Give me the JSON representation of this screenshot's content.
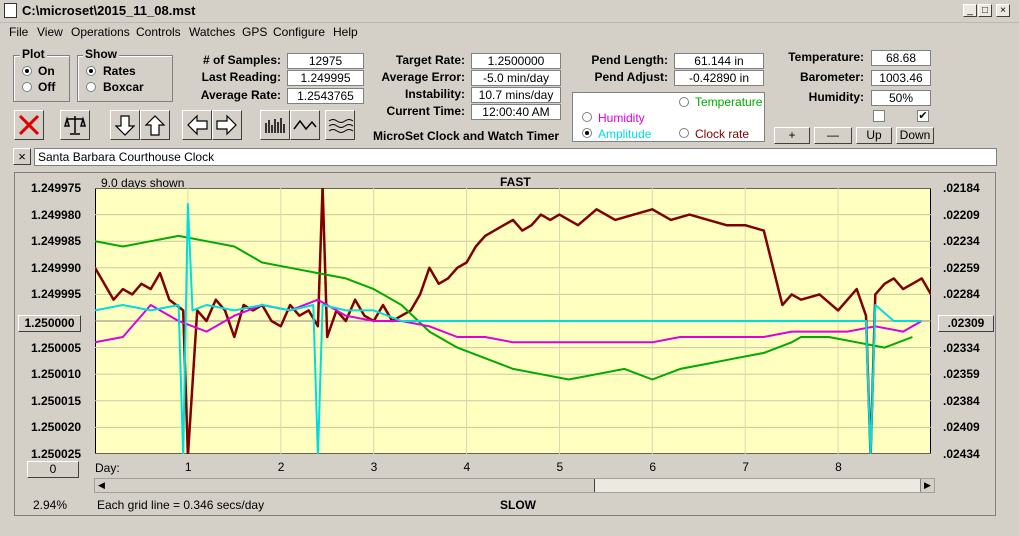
{
  "window": {
    "title": "C:\\microset\\2015_11_08.mst",
    "min": "_",
    "max": "□",
    "close": "×"
  },
  "menu": [
    "File",
    "View",
    "Operations",
    "Controls",
    "Watches",
    "GPS",
    "Configure",
    "Help"
  ],
  "plot_group": {
    "title": "Plot",
    "options": [
      "On",
      "Off"
    ],
    "selected": "On"
  },
  "show_group": {
    "title": "Show",
    "options": [
      "Rates",
      "Boxcar"
    ],
    "selected": "Rates"
  },
  "stats": {
    "samples_label": "# of Samples:",
    "samples": "12975",
    "last_label": "Last Reading:",
    "last": "1.249995",
    "avg_label": "Average Rate:",
    "avg": "1.2543765"
  },
  "rates": {
    "target_label": "Target Rate:",
    "target": "1.2500000",
    "error_label": "Average Error:",
    "error": "-5.0 min/day",
    "instab_label": "Instability:",
    "instab": "10.7 mins/day",
    "time_label": "Current Time:",
    "time": "12:00:40 AM"
  },
  "app_caption": "MicroSet Clock and Watch Timer",
  "pend": {
    "length_label": "Pend Length:",
    "length": "61.144 in",
    "adjust_label": "Pend Adjust:",
    "adjust": "-0.42890 in"
  },
  "series_select": {
    "temperature": "Temperature",
    "humidity": "Humidity",
    "amplitude": "Amplitude",
    "clock_rate": "Clock rate",
    "selected": "Amplitude"
  },
  "env": {
    "temp_label": "Temperature:",
    "temp": "68.68",
    "baro_label": "Barometer:",
    "baro": "1003.46",
    "hum_label": "Humidity:",
    "hum": "50%"
  },
  "adjust_buttons": [
    "+",
    "—",
    "Up",
    "Down"
  ],
  "clock_name": "Santa Barbara Courthouse Clock",
  "close_x": "×",
  "plot": {
    "days_shown": "9.0 days shown",
    "top_label": "FAST",
    "bottom_label": "SLOW",
    "left_center": "1.250000",
    "right_center": ".02309",
    "left_bottom_btn": "0",
    "day_label": "Day:",
    "grid_note": "Each grid line = 0.346 secs/day",
    "percent": "2.94%"
  },
  "chart_data": {
    "type": "line",
    "background": "#ffffc0",
    "ylim_left": [
      1.250025,
      1.249975
    ],
    "y_ticks_left": [
      "1.249975",
      "1.249980",
      "1.249985",
      "1.249990",
      "1.249995",
      "1.250005",
      "1.250010",
      "1.250015",
      "1.250020",
      "1.250025"
    ],
    "y_ticks_right": [
      ".02184",
      ".02209",
      ".02234",
      ".02259",
      ".02284",
      ".02334",
      ".02359",
      ".02384",
      ".02409",
      ".02434"
    ],
    "x_ticks": [
      "1",
      "2",
      "3",
      "4",
      "5",
      "6",
      "7",
      "8"
    ],
    "xlim": [
      0,
      9
    ],
    "series": [
      {
        "color": "#800000",
        "x": [
          0,
          0.1,
          0.2,
          0.3,
          0.4,
          0.5,
          0.6,
          0.7,
          0.8,
          0.95,
          1.0,
          1.1,
          1.2,
          1.3,
          1.4,
          1.5,
          1.6,
          1.7,
          1.8,
          1.9,
          2.0,
          2.1,
          2.2,
          2.3,
          2.4,
          2.45,
          2.5,
          2.6,
          2.7,
          2.8,
          2.9,
          3.0,
          3.1,
          3.2,
          3.3,
          3.4,
          3.5,
          3.6,
          3.7,
          3.8,
          3.9,
          4.0,
          4.1,
          4.2,
          4.3,
          4.4,
          4.5,
          4.6,
          4.7,
          4.8,
          4.9,
          5.0,
          5.2,
          5.4,
          5.6,
          5.8,
          6.0,
          6.2,
          6.4,
          6.6,
          6.8,
          7.0,
          7.2,
          7.4,
          7.5,
          7.6,
          7.8,
          8.0,
          8.2,
          8.3,
          8.35,
          8.4,
          8.5,
          8.6,
          8.7,
          8.8,
          8.9,
          9.0
        ],
        "y": [
          1.24999,
          1.249993,
          1.249996,
          1.249994,
          1.249995,
          1.249993,
          1.249994,
          1.249991,
          1.249996,
          1.249998,
          1.250027,
          1.249998,
          1.25,
          1.249996,
          1.249998,
          1.250003,
          1.249997,
          1.249998,
          1.249997,
          1.25,
          1.250001,
          1.249997,
          1.249999,
          1.249998,
          1.250001,
          1.249971,
          1.250003,
          1.249998,
          1.25,
          1.249996,
          1.249999,
          1.25,
          1.249997,
          1.25,
          1.249999,
          1.249998,
          1.249995,
          1.24999,
          1.249993,
          1.249992,
          1.24999,
          1.249989,
          1.249986,
          1.249984,
          1.249983,
          1.249982,
          1.249981,
          1.249983,
          1.249982,
          1.24998,
          1.249981,
          1.24998,
          1.249982,
          1.249979,
          1.249981,
          1.24998,
          1.249979,
          1.249981,
          1.24998,
          1.249981,
          1.249982,
          1.249982,
          1.249983,
          1.249997,
          1.249995,
          1.249996,
          1.249995,
          1.249998,
          1.249994,
          1.249999,
          1.250027,
          1.249995,
          1.249993,
          1.249992,
          1.249994,
          1.249993,
          1.249992,
          1.249995
        ]
      },
      {
        "color": "#00aa00",
        "x": [
          0,
          0.3,
          0.6,
          0.9,
          1.2,
          1.5,
          1.8,
          2.1,
          2.4,
          2.7,
          3.0,
          3.3,
          3.6,
          3.9,
          4.2,
          4.5,
          4.8,
          5.1,
          5.4,
          5.7,
          6.0,
          6.3,
          6.6,
          6.9,
          7.2,
          7.5,
          7.6,
          7.9,
          8.2,
          8.5,
          8.8
        ],
        "y": [
          1.249985,
          1.249986,
          1.249985,
          1.249984,
          1.249985,
          1.249986,
          1.249989,
          1.24999,
          1.249991,
          1.249992,
          1.249994,
          1.249997,
          1.250002,
          1.250005,
          1.250007,
          1.250009,
          1.25001,
          1.250011,
          1.25001,
          1.250009,
          1.250011,
          1.250009,
          1.250008,
          1.250007,
          1.250006,
          1.250004,
          1.250003,
          1.250003,
          1.250004,
          1.250005,
          1.250003
        ]
      },
      {
        "color": "#dd00dd",
        "x": [
          0,
          0.3,
          0.6,
          0.9,
          1.2,
          1.5,
          1.8,
          2.1,
          2.4,
          2.7,
          3.0,
          3.3,
          3.6,
          3.9,
          4.2,
          4.5,
          4.8,
          5.1,
          5.4,
          5.7,
          6.0,
          6.3,
          6.6,
          6.9,
          7.2,
          7.5,
          7.8,
          8.1,
          8.4,
          8.7,
          8.9
        ],
        "y": [
          1.250004,
          1.250003,
          1.249997,
          1.25,
          1.250002,
          1.249999,
          1.249997,
          1.249998,
          1.249996,
          1.249999,
          1.25,
          1.25,
          1.250001,
          1.250003,
          1.250003,
          1.250004,
          1.250004,
          1.250004,
          1.250004,
          1.250004,
          1.250004,
          1.250003,
          1.250003,
          1.250003,
          1.250003,
          1.250002,
          1.250002,
          1.250002,
          1.250001,
          1.250002,
          1.25
        ]
      },
      {
        "color": "#00dddd",
        "x": [
          0,
          0.3,
          0.6,
          0.9,
          0.95,
          1.0,
          1.05,
          1.2,
          1.5,
          1.8,
          2.1,
          2.35,
          2.4,
          2.45,
          2.7,
          3.0,
          3.3,
          3.6,
          3.9,
          4.2,
          4.5,
          4.8,
          5.1,
          5.4,
          5.7,
          6.0,
          6.3,
          6.6,
          6.9,
          7.2,
          7.5,
          7.8,
          8.1,
          8.3,
          8.35,
          8.4,
          8.6,
          8.9
        ],
        "y": [
          1.249998,
          1.249997,
          1.249998,
          1.249997,
          1.250027,
          1.249978,
          1.249998,
          1.249997,
          1.249998,
          1.249997,
          1.249998,
          1.249997,
          1.250027,
          1.249997,
          1.249998,
          1.249998,
          1.25,
          1.25,
          1.25,
          1.25,
          1.25,
          1.25,
          1.25,
          1.25,
          1.25,
          1.25,
          1.25,
          1.25,
          1.25,
          1.25,
          1.25,
          1.25,
          1.25,
          1.25,
          1.250027,
          1.249997,
          1.25,
          1.25
        ]
      }
    ]
  }
}
